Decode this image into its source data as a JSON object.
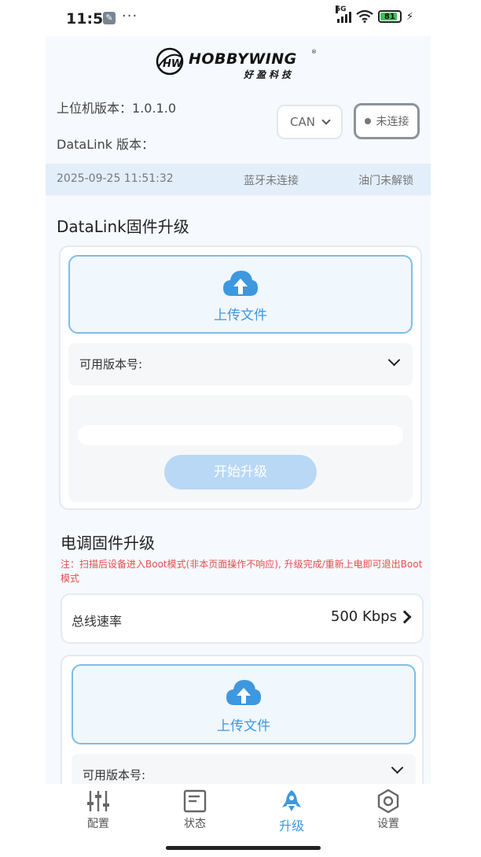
{
  "status_bar": {
    "time": "11:51",
    "more": "···",
    "network": "5G",
    "battery": "81",
    "battery_level": 0.81
  },
  "header": {
    "brand": "HOBBYWING",
    "brand_mark": "®",
    "brand_cn": "好盈科技",
    "emblem": "HW",
    "host_version_label": "上位机版本：",
    "host_version": "1.0.1.0",
    "datalink_version_label": "DataLink 版本：",
    "datalink_version": "",
    "protocol_select": "CAN",
    "connect_button": "未连接"
  },
  "info_bar": {
    "datetime": "2025-09-25 11:51:32",
    "bluetooth_status": "蓝牙未连接",
    "throttle_status": "油门未解锁"
  },
  "datalink_section": {
    "title": "DataLink固件升级",
    "upload_label": "上传文件",
    "version_label": "可用版本号:",
    "version_value": "",
    "progress": 0,
    "start_button": "开始升级"
  },
  "esc_section": {
    "title": "电调固件升级",
    "note": "注：扫描后设备进入Boot模式(非本页面操作不响应), 升级完成/重新上电即可退出Boot模式",
    "bus_rate_label": "总线速率",
    "bus_rate_value": "500 Kbps",
    "upload_label": "上传文件",
    "version_label": "可用版本号:"
  },
  "tabbar": {
    "items": [
      {
        "label": "配置",
        "icon": "sliders-icon"
      },
      {
        "label": "状态",
        "icon": "document-icon"
      },
      {
        "label": "升级",
        "icon": "rocket-icon"
      },
      {
        "label": "设置",
        "icon": "gear-icon"
      }
    ],
    "active_index": 2
  },
  "colors": {
    "accent": "#3d98df",
    "note_red": "#e54e4e",
    "info_bar_bg": "#e2eefa",
    "start_button_disabled": "#b8d8f6"
  }
}
